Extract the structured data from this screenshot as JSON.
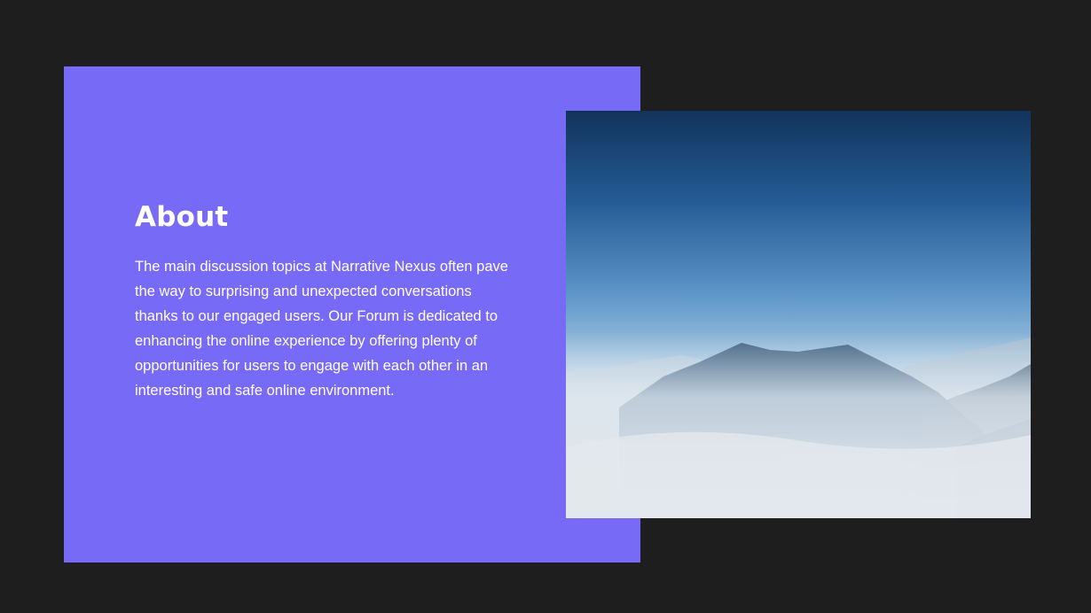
{
  "about": {
    "heading": "About",
    "body": "The main discussion topics at Narrative Nexus often pave the way to surprising and unexpected conversations thanks to our engaged users. Our Forum is dedicated to enhancing the online experience by offering plenty of opportunities for users to engage with each other in an interesting and safe online environment."
  },
  "image": {
    "subject": "mountain-peaks-above-clouds"
  },
  "colors": {
    "background": "#1e1e1e",
    "panel": "#766af6",
    "text": "#ffffff",
    "sky_top": "#14365e",
    "sky_mid": "#5b93c8",
    "mist": "#e4e9ee"
  }
}
